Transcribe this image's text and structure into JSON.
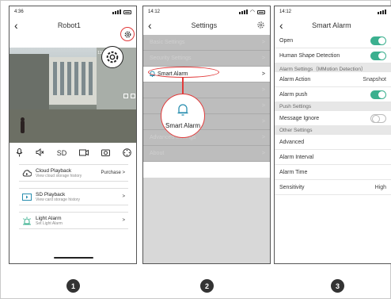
{
  "phone1": {
    "time": "4:36",
    "title": "Robot1",
    "video_overlay": "116.1KB/s",
    "controls": [
      "SD"
    ],
    "cards": [
      {
        "title": "Cloud Playback",
        "sub": "View cloud storage history",
        "right": "Purchase >"
      },
      {
        "title": "SD Playback",
        "sub": "View card storage history",
        "right": ">"
      },
      {
        "title": "Light Alarm",
        "sub": "Set Light Alarm",
        "right": ">"
      }
    ]
  },
  "phone2": {
    "time": "14:12",
    "title": "Settings",
    "menu": [
      "Basic Settings",
      "Security Settings",
      "Smart Alarm",
      "",
      "",
      "",
      "Advanced Settings",
      "About"
    ],
    "active_item": "Smart Alarm",
    "callout_label": "Smart Alarm"
  },
  "phone3": {
    "time": "14:12",
    "title": "Smart Alarm",
    "rows": {
      "open": "Open",
      "human": "Human Shape Detection",
      "alarm_settings_hdr": "Alarm Settings（MMotion Detection）",
      "alarm_action": "Alarm Action",
      "alarm_action_val": "Snapshot",
      "alarm_push": "Alarm push",
      "push_hdr": "Push Settings",
      "message_ignore": "Message Ignore",
      "other_hdr": "Other Settings",
      "advanced": "Advanced",
      "alarm_interval": "Alarm Interval",
      "alarm_time": "Alarm Time",
      "sensitivity": "Sensitivity",
      "sensitivity_val": "High"
    }
  },
  "steps": [
    "1",
    "2",
    "3"
  ],
  "colors": {
    "accent": "#3bb08f",
    "highlight": "#e23a3a"
  }
}
